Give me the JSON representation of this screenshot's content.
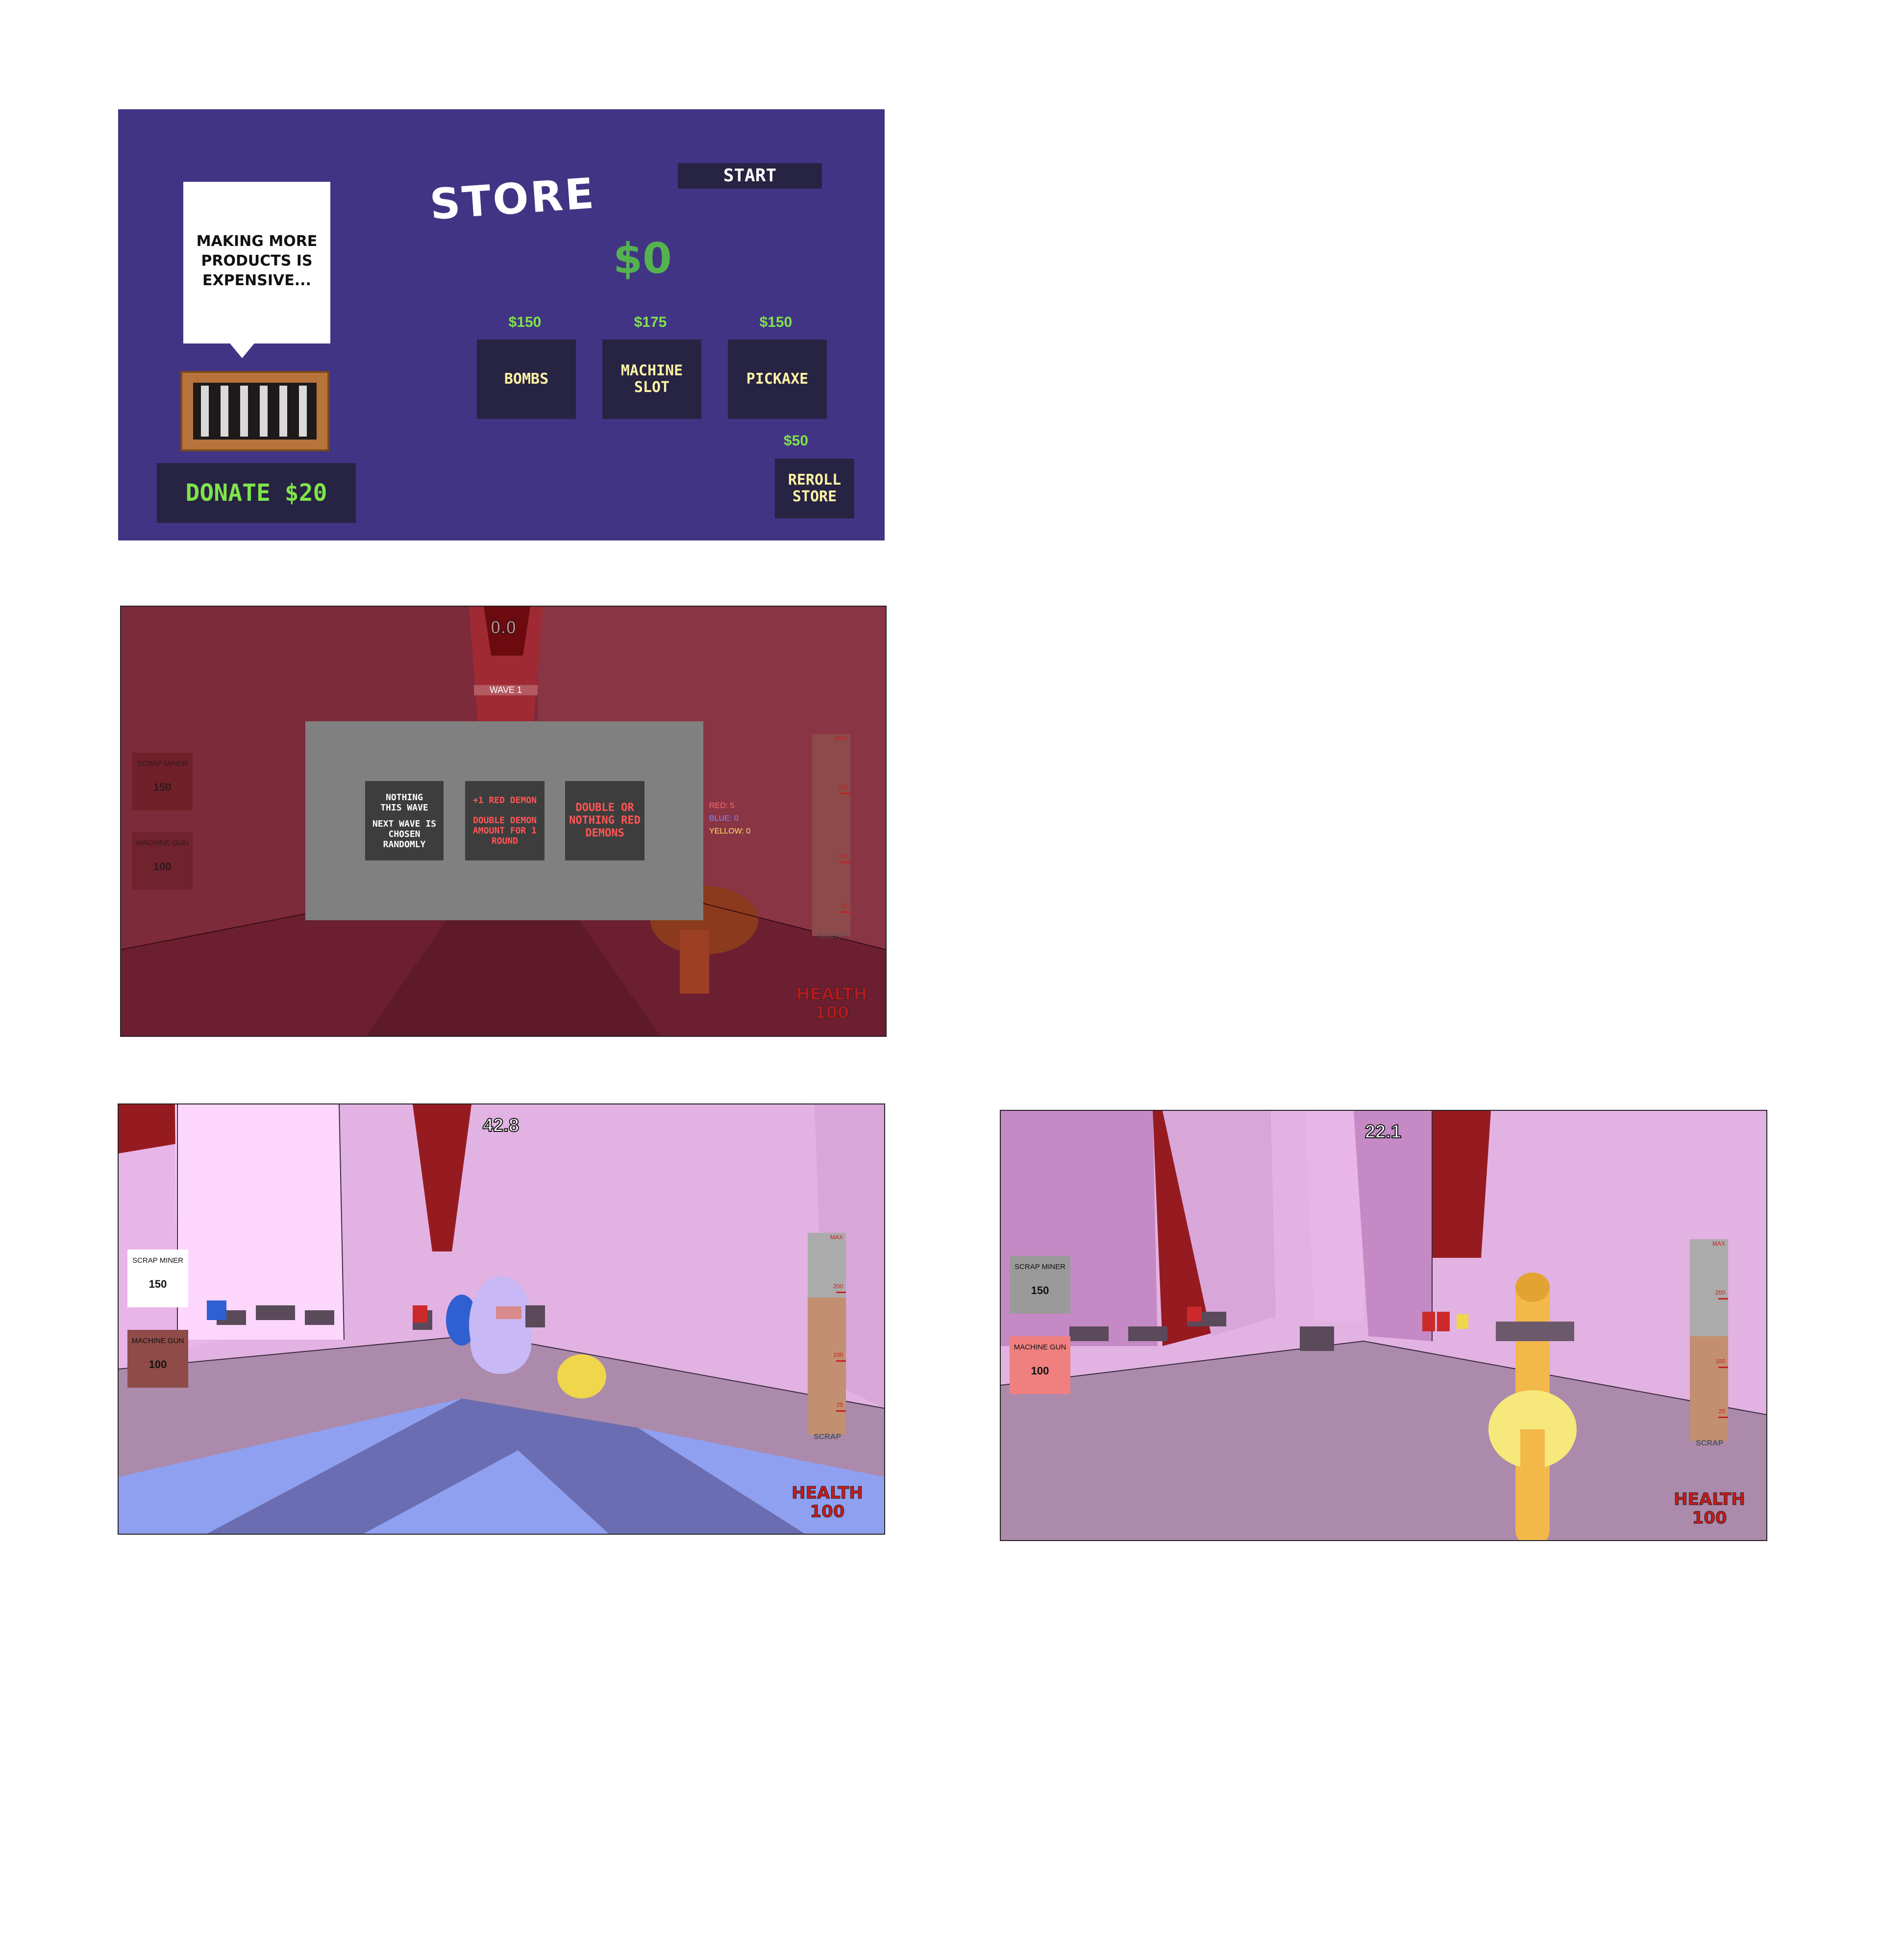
{
  "store": {
    "speech": "MAKING MORE PRODUCTS IS EXPENSIVE...",
    "title": "STORE",
    "start_label": "START",
    "money": "$0",
    "donate_label": "DONATE $20",
    "items": [
      {
        "price": "$150",
        "label": "BOMBS"
      },
      {
        "price": "$175",
        "label": "MACHINE SLOT"
      },
      {
        "price": "$150",
        "label": "PICKAXE"
      }
    ],
    "reroll": {
      "price": "$50",
      "label": "REROLL STORE"
    },
    "colors": {
      "background": "#423484",
      "button": "#272343",
      "price": "#7fe34a",
      "item_text": "#fff3a3"
    }
  },
  "wave_screen": {
    "timer": "0.0",
    "wave_label": "WAVE 1",
    "scrap_miner": {
      "label": "SCRAP MINER",
      "value": "150"
    },
    "machine_gun": {
      "label": "MACHINE GUN",
      "value": "100"
    },
    "choices": [
      {
        "line1": "NOTHING THIS WAVE",
        "line2": "NEXT WAVE IS CHOSEN RANDOMLY"
      },
      {
        "line1": "+1 RED DEMON",
        "line2": "DOUBLE DEMON AMOUNT FOR 1 ROUND"
      },
      {
        "line1": "DOUBLE OR NOTHING RED DEMONS",
        "line2": ""
      }
    ],
    "demon_counts": {
      "red": "RED: 5",
      "blue": "BLUE: 0",
      "yellow": "YELLOW: 0"
    },
    "gauge": {
      "max_label": "MAX",
      "ticks": [
        "200",
        "100",
        "25"
      ],
      "label": "SCRAP",
      "level": 0
    },
    "health_label": "HEALTH",
    "health_value": "100"
  },
  "gameplay_1": {
    "timer": "42.8",
    "scrap_miner": {
      "label": "SCRAP MINER",
      "value": "150"
    },
    "machine_gun": {
      "label": "MACHINE GUN",
      "value": "100"
    },
    "gauge": {
      "max_label": "MAX",
      "ticks": [
        "200",
        "100",
        "25"
      ],
      "label": "SCRAP",
      "level": 0.68
    },
    "health_label": "HEALTH",
    "health_value": "100"
  },
  "gameplay_2": {
    "timer": "22.1",
    "scrap_miner": {
      "label": "SCRAP MINER",
      "value": "150"
    },
    "machine_gun": {
      "label": "MACHINE GUN",
      "value": "100"
    },
    "gauge": {
      "max_label": "MAX",
      "ticks": [
        "200",
        "100",
        "25"
      ],
      "label": "SCRAP",
      "level": 0.52
    },
    "health_label": "HEALTH",
    "health_value": "100"
  }
}
